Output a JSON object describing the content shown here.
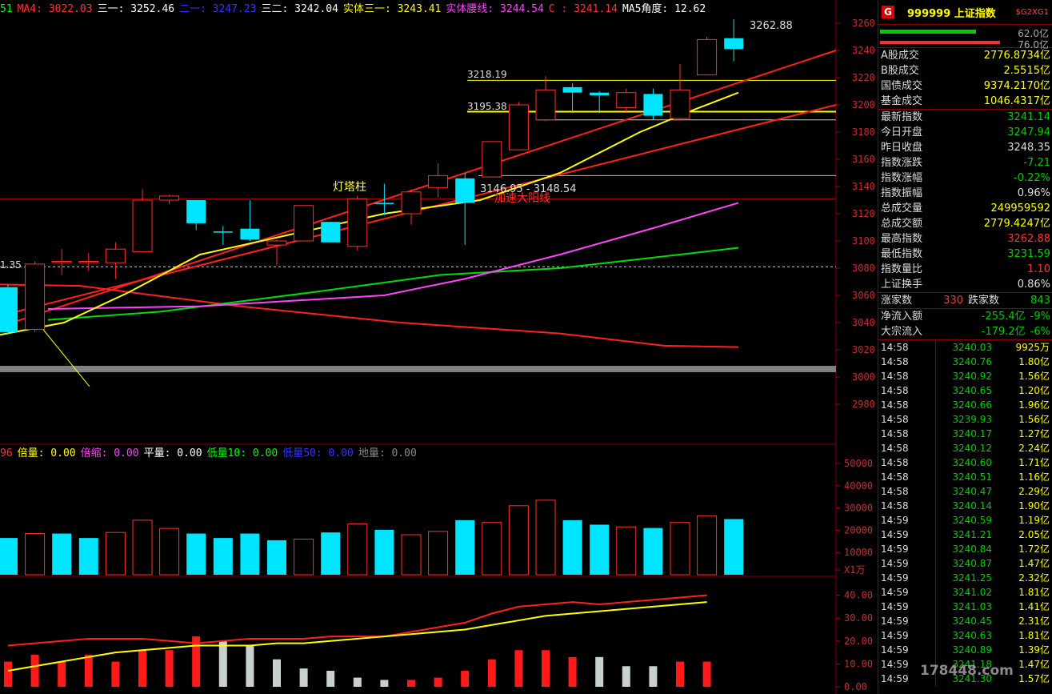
{
  "indicators": {
    "ma": [
      {
        "label": "51",
        "color": "#00ff00"
      },
      {
        "label": "MA4: 3022.03",
        "color": "#ff3333"
      },
      {
        "label": "三一: 3252.46",
        "color": "#ffffff"
      },
      {
        "label": "二一: 3247.23",
        "color": "#3333ff"
      },
      {
        "label": "三二: 3242.04",
        "color": "#ffffff"
      },
      {
        "label": "实体三一: 3243.41",
        "color": "#ffff00"
      },
      {
        "label": "实体腰线: 3244.54",
        "color": "#ff44ff"
      },
      {
        "label": "C  : 3241.14",
        "color": "#ff3333"
      },
      {
        "label": "MA5角度: 12.62",
        "color": "#ffffff"
      }
    ],
    "vol": [
      {
        "label": "96",
        "color": "#ff3333"
      },
      {
        "label": "倍量: 0.00",
        "color": "#ffff00"
      },
      {
        "label": "倍缩: 0.00",
        "color": "#ff44ff"
      },
      {
        "label": "平量: 0.00",
        "color": "#ffffff"
      },
      {
        "label": "低量10: 0.00",
        "color": "#00ff00"
      },
      {
        "label": "低量50: 0.00",
        "color": "#3333ff"
      },
      {
        "label": "地量: 0.00",
        "color": "#888888"
      }
    ]
  },
  "annotations": {
    "high": "3262.88",
    "level1": "3218.19",
    "level2": "3195.38",
    "range": "3146.95 - 3148.54",
    "lighthouse": "灯塔柱",
    "accel": "加速大阳线",
    "left_price": "1.35"
  },
  "price_axis": [
    "3260",
    "3240",
    "3220",
    "3200",
    "3180",
    "3160",
    "3140",
    "3120",
    "3100",
    "3080",
    "3060",
    "3040",
    "3020",
    "3000",
    "2980"
  ],
  "vol_axis": [
    "50000",
    "40000",
    "30000",
    "20000",
    "10000",
    "X1万"
  ],
  "osc_axis": [
    "40.00",
    "30.00",
    "20.00",
    "10.00",
    "0.00"
  ],
  "chart_data": {
    "type": "candlestick",
    "candles": [
      {
        "o": 3033,
        "c": 3066,
        "h": 3068,
        "l": 3031,
        "up": false
      },
      {
        "o": 3035,
        "c": 3083,
        "h": 3085,
        "l": 3033,
        "up": true
      },
      {
        "o": 3085,
        "c": 3085,
        "h": 3094,
        "l": 3075,
        "up": true
      },
      {
        "o": 3085,
        "c": 3085,
        "h": 3091,
        "l": 3078,
        "up": true
      },
      {
        "o": 3084,
        "c": 3094,
        "h": 3099,
        "l": 3072,
        "up": true
      },
      {
        "o": 3092,
        "c": 3130,
        "h": 3138,
        "l": 3092,
        "up": true
      },
      {
        "o": 3130,
        "c": 3133,
        "h": 3134,
        "l": 3127,
        "up": true
      },
      {
        "o": 3130,
        "c": 3113,
        "h": 3130,
        "l": 3108,
        "up": false
      },
      {
        "o": 3107,
        "c": 3107,
        "h": 3111,
        "l": 3097,
        "up": false
      },
      {
        "o": 3109,
        "c": 3101,
        "h": 3130,
        "l": 3100,
        "up": false
      },
      {
        "o": 3097,
        "c": 3100,
        "h": 3101,
        "l": 3082,
        "up": true
      },
      {
        "o": 3100,
        "c": 3126,
        "h": 3126,
        "l": 3100,
        "up": true
      },
      {
        "o": 3114,
        "c": 3099,
        "h": 3114,
        "l": 3099,
        "up": false
      },
      {
        "o": 3096,
        "c": 3131,
        "h": 3133,
        "l": 3093,
        "up": true
      },
      {
        "o": 3128,
        "c": 3128,
        "h": 3142,
        "l": 3119,
        "up": false
      },
      {
        "o": 3120,
        "c": 3136,
        "h": 3138,
        "l": 3112,
        "up": true
      },
      {
        "o": 3139,
        "c": 3148,
        "h": 3157,
        "l": 3132,
        "up": true
      },
      {
        "o": 3146,
        "c": 3128,
        "h": 3150,
        "l": 3097,
        "up": false
      },
      {
        "o": 3147,
        "c": 3173,
        "h": 3173,
        "l": 3147,
        "up": true
      },
      {
        "o": 3167,
        "c": 3200,
        "h": 3202,
        "l": 3167,
        "up": true
      },
      {
        "o": 3189,
        "c": 3211,
        "h": 3221,
        "l": 3188,
        "up": true
      },
      {
        "o": 3213,
        "c": 3209,
        "h": 3216,
        "l": 3194,
        "up": false
      },
      {
        "o": 3209,
        "c": 3207,
        "h": 3210,
        "l": 3194,
        "up": false
      },
      {
        "o": 3209,
        "c": 3198,
        "h": 3212,
        "l": 3195,
        "up": true
      },
      {
        "o": 3208,
        "c": 3192,
        "h": 3212,
        "l": 3189,
        "up": false
      },
      {
        "o": 3190,
        "c": 3211,
        "h": 3230,
        "l": 3189,
        "up": true
      },
      {
        "o": 3222,
        "c": 3248,
        "h": 3250,
        "l": 3222,
        "up": true
      },
      {
        "o": 3249,
        "c": 3241,
        "h": 3263,
        "l": 3232,
        "up": false
      }
    ],
    "volumes": [
      {
        "v": 16500,
        "up": false
      },
      {
        "v": 18500,
        "up": true
      },
      {
        "v": 18500,
        "up": false
      },
      {
        "v": 16500,
        "up": false
      },
      {
        "v": 19000,
        "up": true
      },
      {
        "v": 24500,
        "up": true
      },
      {
        "v": 20800,
        "up": true
      },
      {
        "v": 18500,
        "up": false
      },
      {
        "v": 16500,
        "up": false
      },
      {
        "v": 18500,
        "up": false
      },
      {
        "v": 15500,
        "up": false
      },
      {
        "v": 16000,
        "up": true
      },
      {
        "v": 19000,
        "up": false
      },
      {
        "v": 22800,
        "up": true
      },
      {
        "v": 20200,
        "up": false
      },
      {
        "v": 18000,
        "up": true
      },
      {
        "v": 19500,
        "up": true
      },
      {
        "v": 24500,
        "up": false
      },
      {
        "v": 23500,
        "up": true
      },
      {
        "v": 31000,
        "up": true
      },
      {
        "v": 33500,
        "up": true
      },
      {
        "v": 24500,
        "up": false
      },
      {
        "v": 22500,
        "up": false
      },
      {
        "v": 21500,
        "up": true
      },
      {
        "v": 21000,
        "up": false
      },
      {
        "v": 23500,
        "up": true
      },
      {
        "v": 26500,
        "up": true
      },
      {
        "v": 25000,
        "up": false
      }
    ],
    "osc_bars": [
      {
        "v": 11,
        "c": "red"
      },
      {
        "v": 14,
        "c": "red"
      },
      {
        "v": 11,
        "c": "red"
      },
      {
        "v": 14,
        "c": "red"
      },
      {
        "v": 11,
        "c": "red"
      },
      {
        "v": 16,
        "c": "red"
      },
      {
        "v": 16,
        "c": "red"
      },
      {
        "v": 22,
        "c": "red"
      },
      {
        "v": 20,
        "c": "grey"
      },
      {
        "v": 18,
        "c": "grey"
      },
      {
        "v": 12,
        "c": "grey"
      },
      {
        "v": 8,
        "c": "grey"
      },
      {
        "v": 7,
        "c": "grey"
      },
      {
        "v": 4,
        "c": "grey"
      },
      {
        "v": 3,
        "c": "grey"
      },
      {
        "v": 3,
        "c": "red"
      },
      {
        "v": 4,
        "c": "red"
      },
      {
        "v": 7,
        "c": "red"
      },
      {
        "v": 12,
        "c": "red"
      },
      {
        "v": 16,
        "c": "red"
      },
      {
        "v": 16,
        "c": "red"
      },
      {
        "v": 13,
        "c": "red"
      },
      {
        "v": 13,
        "c": "grey"
      },
      {
        "v": 9,
        "c": "grey"
      },
      {
        "v": 9,
        "c": "grey"
      },
      {
        "v": 11,
        "c": "red"
      },
      {
        "v": 11,
        "c": "red"
      }
    ],
    "osc_red": [
      18,
      19,
      20,
      21,
      21,
      21,
      20,
      19,
      20,
      21,
      21,
      21,
      22,
      22,
      22,
      24,
      26,
      28,
      32,
      35,
      36,
      37,
      36,
      37,
      38,
      39,
      40
    ],
    "osc_yellow": [
      7,
      9,
      11,
      13,
      15,
      16,
      17,
      18,
      18,
      18,
      19,
      19,
      20,
      21,
      22,
      23,
      24,
      25,
      27,
      29,
      31,
      32,
      33,
      34,
      35,
      36,
      37
    ]
  },
  "panel": {
    "badge": "G",
    "name": "999999 上证指数",
    "tag": "$G2XG1",
    "bar1": "62.0亿",
    "bar2": "76.0亿",
    "rows": [
      {
        "k": "A股成交",
        "v": "2776.8734亿",
        "c": "#ffff00"
      },
      {
        "k": "B股成交",
        "v": "2.5515亿",
        "c": "#ffff00"
      },
      {
        "k": "国债成交",
        "v": "9374.2170亿",
        "c": "#ffff00"
      },
      {
        "k": "基金成交",
        "v": "1046.4317亿",
        "c": "#ffff00"
      },
      {
        "k": "最新指数",
        "v": "3241.14",
        "c": "#00cc00"
      },
      {
        "k": "今日开盘",
        "v": "3247.94",
        "c": "#00cc00"
      },
      {
        "k": "昨日收盘",
        "v": "3248.35",
        "c": "#dddddd"
      },
      {
        "k": "指数涨跌",
        "v": "-7.21",
        "c": "#00cc00"
      },
      {
        "k": "指数涨幅",
        "v": "-0.22%",
        "c": "#00cc00"
      },
      {
        "k": "指数振幅",
        "v": "0.96%",
        "c": "#dddddd"
      },
      {
        "k": "总成交量",
        "v": "249959592",
        "c": "#ffff00"
      },
      {
        "k": "总成交额",
        "v": "2779.4247亿",
        "c": "#ffff00"
      },
      {
        "k": "最高指数",
        "v": "3262.88",
        "c": "#ff3333"
      },
      {
        "k": "最低指数",
        "v": "3231.59",
        "c": "#00cc00"
      },
      {
        "k": "指数量比",
        "v": "1.10",
        "c": "#ff3333"
      },
      {
        "k": "上证换手",
        "v": "0.86%",
        "c": "#dddddd"
      }
    ],
    "updown": {
      "up_label": "涨家数",
      "up": "330",
      "down_label": "跌家数",
      "down": "843"
    },
    "flows": [
      {
        "k": "净流入额",
        "v": "-255.4亿",
        "p": "-9%"
      },
      {
        "k": "大宗流入",
        "v": "-179.2亿",
        "p": "-6%"
      }
    ],
    "ticks": [
      {
        "t": "14:58",
        "p": "3240.03",
        "v": "9925万"
      },
      {
        "t": "14:58",
        "p": "3240.76",
        "v": "1.80亿"
      },
      {
        "t": "14:58",
        "p": "3240.92",
        "v": "1.56亿"
      },
      {
        "t": "14:58",
        "p": "3240.65",
        "v": "1.20亿"
      },
      {
        "t": "14:58",
        "p": "3240.66",
        "v": "1.96亿"
      },
      {
        "t": "14:58",
        "p": "3239.93",
        "v": "1.56亿"
      },
      {
        "t": "14:58",
        "p": "3240.17",
        "v": "1.27亿"
      },
      {
        "t": "14:58",
        "p": "3240.12",
        "v": "2.24亿"
      },
      {
        "t": "14:58",
        "p": "3240.60",
        "v": "1.71亿"
      },
      {
        "t": "14:58",
        "p": "3240.51",
        "v": "1.16亿"
      },
      {
        "t": "14:58",
        "p": "3240.47",
        "v": "2.29亿"
      },
      {
        "t": "14:58",
        "p": "3240.14",
        "v": "1.90亿"
      },
      {
        "t": "14:59",
        "p": "3240.59",
        "v": "1.19亿"
      },
      {
        "t": "14:59",
        "p": "3241.21",
        "v": "2.05亿"
      },
      {
        "t": "14:59",
        "p": "3240.84",
        "v": "1.72亿"
      },
      {
        "t": "14:59",
        "p": "3240.87",
        "v": "1.47亿"
      },
      {
        "t": "14:59",
        "p": "3241.25",
        "v": "2.32亿"
      },
      {
        "t": "14:59",
        "p": "3241.02",
        "v": "1.81亿"
      },
      {
        "t": "14:59",
        "p": "3241.03",
        "v": "1.41亿"
      },
      {
        "t": "14:59",
        "p": "3240.45",
        "v": "2.31亿"
      },
      {
        "t": "14:59",
        "p": "3240.63",
        "v": "1.81亿"
      },
      {
        "t": "14:59",
        "p": "3240.89",
        "v": "1.39亿"
      },
      {
        "t": "14:59",
        "p": "3241.18",
        "v": "1.47亿"
      },
      {
        "t": "14:59",
        "p": "3241.30",
        "v": "1.57亿"
      }
    ],
    "watermark": "178448.com"
  }
}
